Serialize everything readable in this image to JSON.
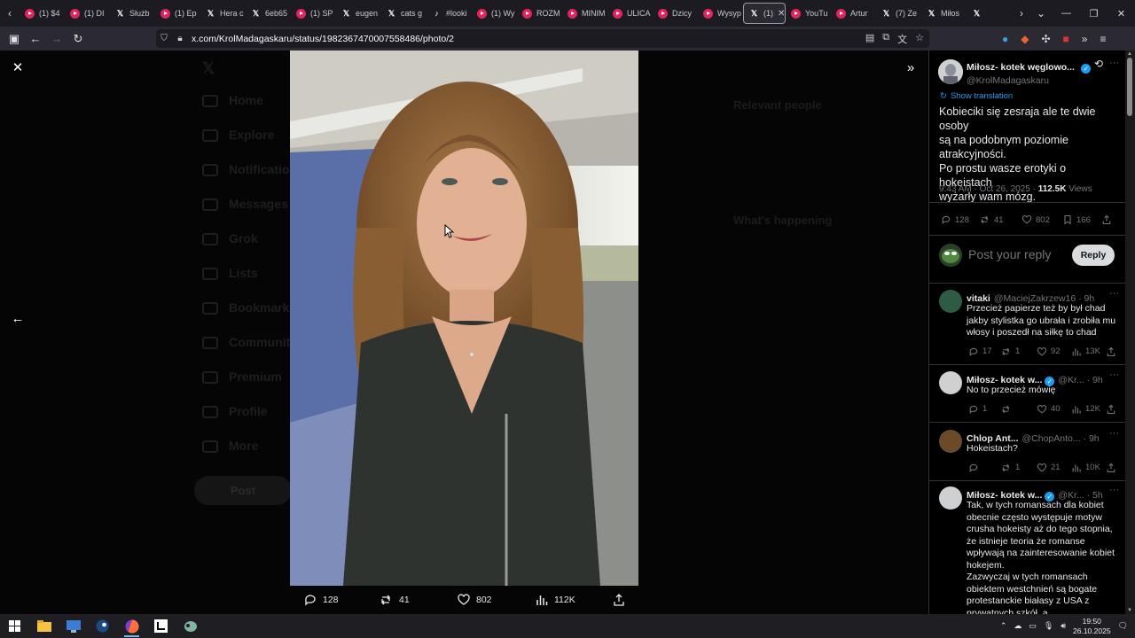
{
  "browser": {
    "tabs": [
      {
        "icon": "youtube-icon",
        "label": "(1) $4"
      },
      {
        "icon": "youtube-icon",
        "label": "(1) DI"
      },
      {
        "icon": "x-logo-icon",
        "label": "Służb"
      },
      {
        "icon": "youtube-icon",
        "label": "(1) Ep"
      },
      {
        "icon": "x-logo-icon",
        "label": "Hera c"
      },
      {
        "icon": "x-logo-icon",
        "label": "6eb65"
      },
      {
        "icon": "youtube-icon",
        "label": "(1) SP"
      },
      {
        "icon": "x-logo-icon",
        "label": "eugen"
      },
      {
        "icon": "x-logo-icon",
        "label": "cats g"
      },
      {
        "icon": "tiktok-icon",
        "label": "#looki"
      },
      {
        "icon": "youtube-icon",
        "label": "(1) Wy"
      },
      {
        "icon": "youtube-icon",
        "label": "ROZM"
      },
      {
        "icon": "youtube-icon",
        "label": "MINIM"
      },
      {
        "icon": "youtube-icon",
        "label": "ULICA"
      },
      {
        "icon": "youtube-icon",
        "label": "Dzicy"
      },
      {
        "icon": "youtube-icon",
        "label": "Wysyp"
      },
      {
        "icon": "x-logo-icon",
        "label": "(1)",
        "active": true
      },
      {
        "icon": "youtube-icon",
        "label": "YouTu"
      },
      {
        "icon": "youtube-icon",
        "label": "Artur"
      },
      {
        "icon": "x-logo-icon",
        "label": "(7) Ze"
      },
      {
        "icon": "x-logo-icon",
        "label": "Miłos"
      },
      {
        "icon": "x-logo-icon",
        "label": ""
      }
    ],
    "url": "x.com/KrolMadagaskaru/status/1982367470007558486/photo/2"
  },
  "background": {
    "nav": [
      "Home",
      "Explore",
      "Notifications",
      "Messages",
      "Grok",
      "Lists",
      "Bookmarks",
      "Communities",
      "Premium",
      "Profile",
      "More"
    ],
    "post_button": "Post",
    "relevant_people": "Relevant people",
    "whats_happening": "What's happening"
  },
  "photo_actions": {
    "replies": "128",
    "reposts": "41",
    "likes": "802",
    "views": "112K"
  },
  "post": {
    "author_name": "Miłosz- kotek węglowo...",
    "author_handle": "@KrolMadagaskaru",
    "show_translation": "Show translation",
    "text_lines": [
      "Kobieciki się zesraja ale te dwie osoby",
      "są na podobnym poziomie",
      "atrakcyjności.",
      "Po prostu wasze erotyki o hokeistach",
      "wyżarły wam mózg."
    ],
    "time": "9:43 AM · Oct 26, 2025 · ",
    "views_count": "112.5K",
    "views_label": " Views",
    "replies": "128",
    "reposts": "41",
    "likes": "802",
    "bookmarks": "166"
  },
  "composer": {
    "placeholder": "Post your reply",
    "reply_button": "Reply"
  },
  "replies": [
    {
      "name": "vitaki",
      "handle": "@MaciejZakrzew16 · 9h",
      "text_lines": [
        "Przecież papierze też by był chad",
        "jakby stylistka go ubrała i zrobiła mu",
        "włosy i poszedł na siłkę to chad"
      ],
      "replies": "17",
      "reposts": "1",
      "likes": "92",
      "views": "13K"
    },
    {
      "name": "Miłosz- kotek w...",
      "handle": "@Kr... · 9h",
      "text_lines": [
        "No to przecież mówię"
      ],
      "replies": "1",
      "reposts": "",
      "likes": "40",
      "views": "12K"
    },
    {
      "name": "Chlop Ant...",
      "handle": "@ChopAnto... · 9h",
      "text_lines": [
        "Hokeistach?"
      ],
      "replies": "",
      "reposts": "1",
      "likes": "21",
      "views": "10K"
    },
    {
      "name": "Miłosz- kotek w...",
      "handle": "@Kr... · 5h",
      "text_lines": [
        "Tak, w tych romansach dla kobiet",
        "obecnie często występuje motyw",
        "crusha hokeisty aż do tego stopnia,",
        "że istnieje teoria że romanse",
        "wpływają na zainteresowanie kobiet",
        "hokejem.",
        "Zazwyczaj w tych romansach",
        "obiektem westchnień są bogate",
        "protestanckie białasy z USA z",
        "prywatnych szkół, a"
      ]
    }
  ],
  "taskbar": {
    "time": "19:50",
    "date": "26.10.2025"
  },
  "colors": {
    "accent": "#1d9bf0",
    "muted": "#71767b",
    "reply_button": "#eff3f4"
  }
}
